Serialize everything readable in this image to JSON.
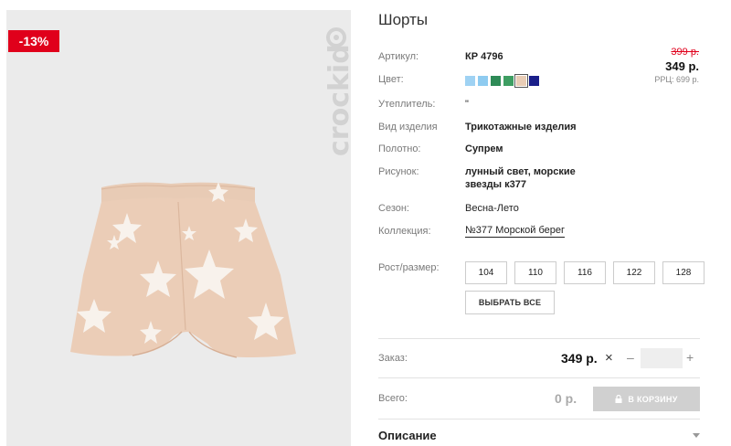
{
  "product": {
    "title": "Шорты",
    "discount_badge": "-13%",
    "brand_watermark": "crockid"
  },
  "price": {
    "old": "399 р.",
    "current": "349 р.",
    "rrp": "РРЦ: 699 р."
  },
  "specs": {
    "article_label": "Артикул:",
    "article_value": "КР 4796",
    "color_label": "Цвет:",
    "insulation_label": "Утеплитель:",
    "insulation_value": "\"",
    "type_label": "Вид изделия",
    "type_value": "Трикотажные изделия",
    "fabric_label": "Полотно:",
    "fabric_value": "Супрем",
    "pattern_label": "Рисунок:",
    "pattern_line1": "лунный свет, морские",
    "pattern_line2": "звезды к377",
    "season_label": "Сезон:",
    "season_value": "Весна-Лето",
    "collection_label": "Коллекция:",
    "collection_value": "№377 Морской берег"
  },
  "colors": [
    "#9fd2f3",
    "#8ecbf0",
    "#2e8b57",
    "#3e9e62",
    "#e9cdb6",
    "#1a1f8a"
  ],
  "selected_color_index": 4,
  "sizes": {
    "label": "Рост/размер:",
    "options": [
      "104",
      "110",
      "116",
      "122",
      "128"
    ],
    "select_all": "ВЫБРАТЬ ВСЕ"
  },
  "order": {
    "label": "Заказ:",
    "price": "349 р.",
    "times": "×",
    "minus": "–",
    "plus": "+",
    "quantity": ""
  },
  "total": {
    "label": "Всего:",
    "value": "0 р.",
    "cart_button": "В КОРЗИНУ"
  },
  "description": {
    "label": "Описание"
  }
}
